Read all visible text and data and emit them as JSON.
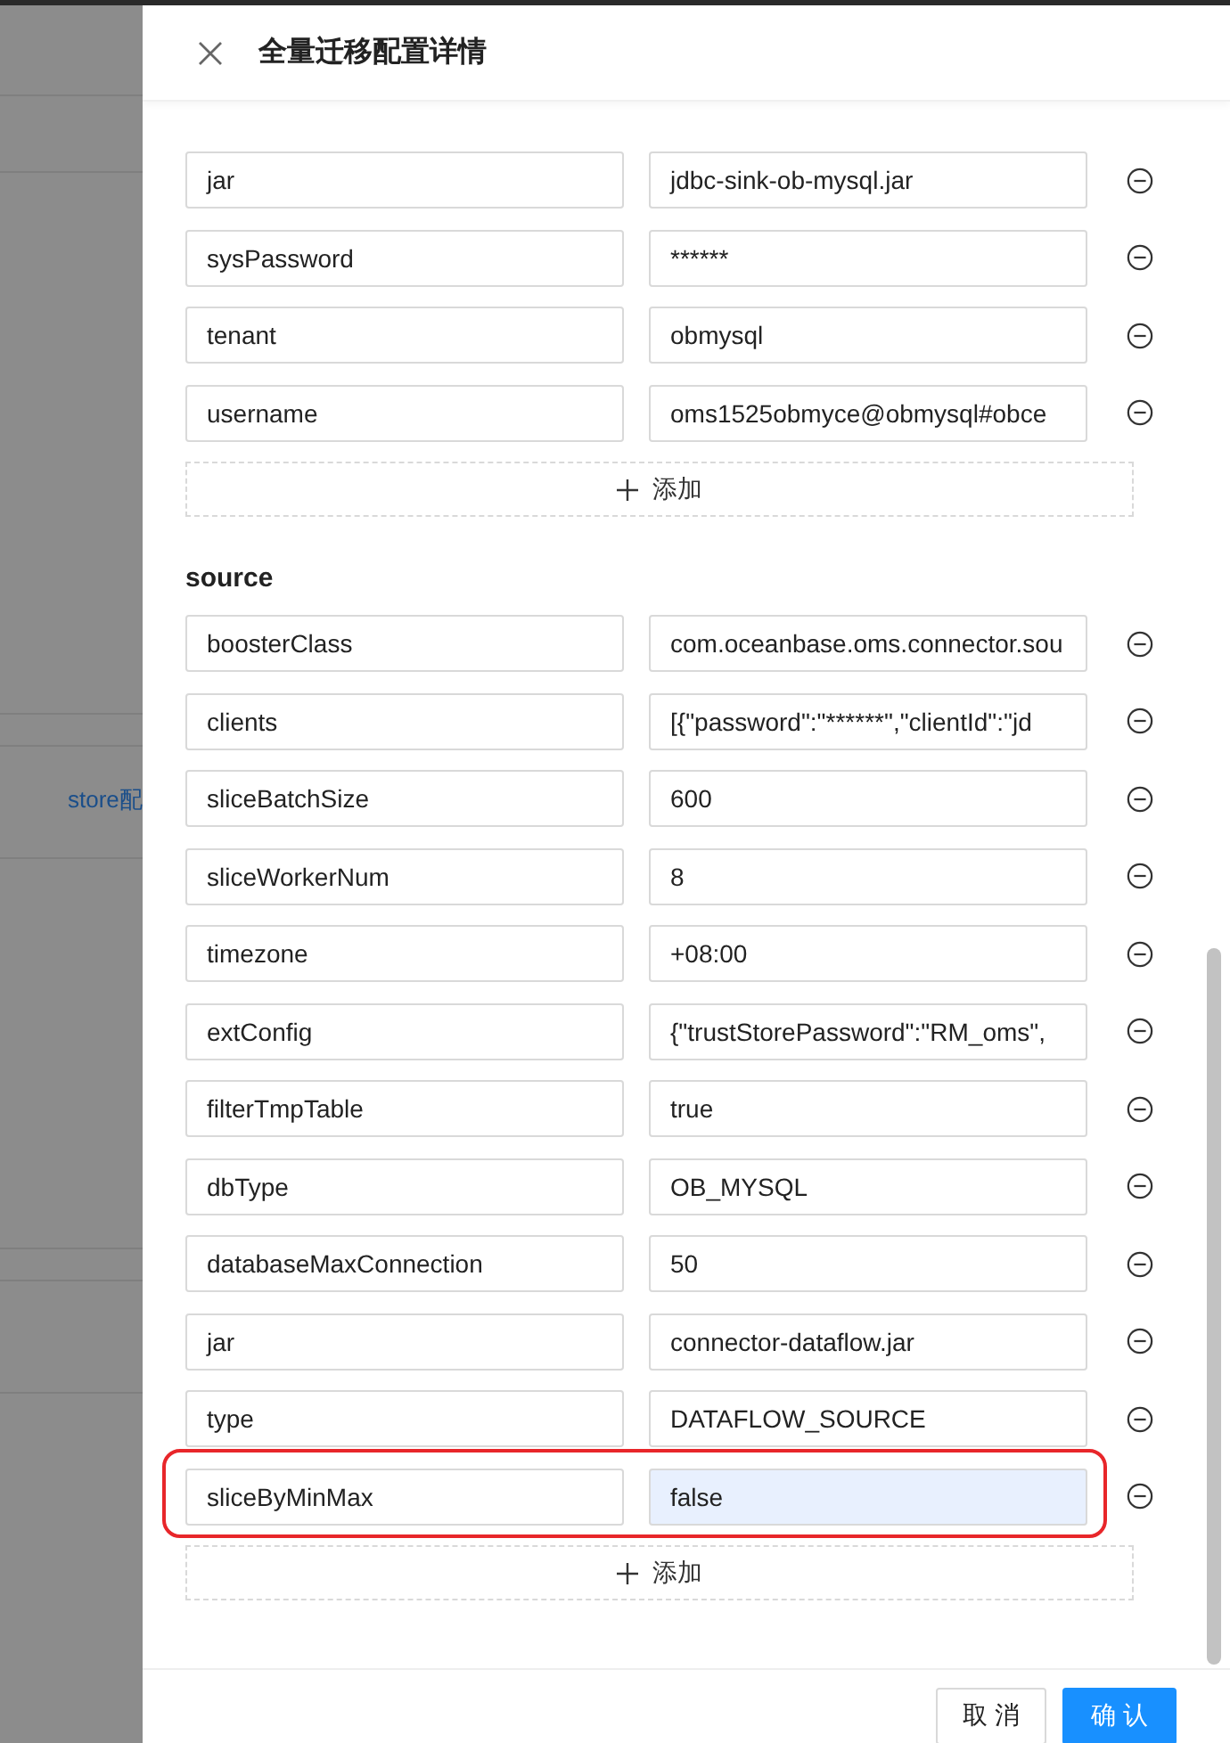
{
  "background": {
    "link": "store配"
  },
  "drawer": {
    "title": "全量迁移配置详情"
  },
  "sections": [
    {
      "rows": [
        {
          "key": "jar",
          "value": "jdbc-sink-ob-mysql.jar",
          "highlighted": false
        },
        {
          "key": "sysPassword",
          "value": "******",
          "highlighted": false
        },
        {
          "key": "tenant",
          "value": "obmysql",
          "highlighted": false
        },
        {
          "key": "username",
          "value": "oms1525obmyce@obmysql#obce",
          "highlighted": false
        }
      ],
      "add_label": "添加"
    },
    {
      "title": "source",
      "rows": [
        {
          "key": "boosterClass",
          "value": "com.oceanbase.oms.connector.sou",
          "highlighted": false
        },
        {
          "key": "clients",
          "value": "[{\"password\":\"******\",\"clientId\":\"jd",
          "highlighted": false
        },
        {
          "key": "sliceBatchSize",
          "value": "600",
          "highlighted": false
        },
        {
          "key": "sliceWorkerNum",
          "value": "8",
          "highlighted": false
        },
        {
          "key": "timezone",
          "value": "+08:00",
          "highlighted": false
        },
        {
          "key": "extConfig",
          "value": "{\"trustStorePassword\":\"RM_oms\",",
          "highlighted": false
        },
        {
          "key": "filterTmpTable",
          "value": "true",
          "highlighted": false
        },
        {
          "key": "dbType",
          "value": "OB_MYSQL",
          "highlighted": false
        },
        {
          "key": "databaseMaxConnection",
          "value": "50",
          "highlighted": false
        },
        {
          "key": "jar",
          "value": "connector-dataflow.jar",
          "highlighted": false
        },
        {
          "key": "type",
          "value": "DATAFLOW_SOURCE",
          "highlighted": false
        },
        {
          "key": "sliceByMinMax",
          "value": "false",
          "highlighted": true
        }
      ],
      "add_label": "添加"
    }
  ],
  "footer": {
    "cancel": "取 消",
    "confirm": "确 认"
  }
}
